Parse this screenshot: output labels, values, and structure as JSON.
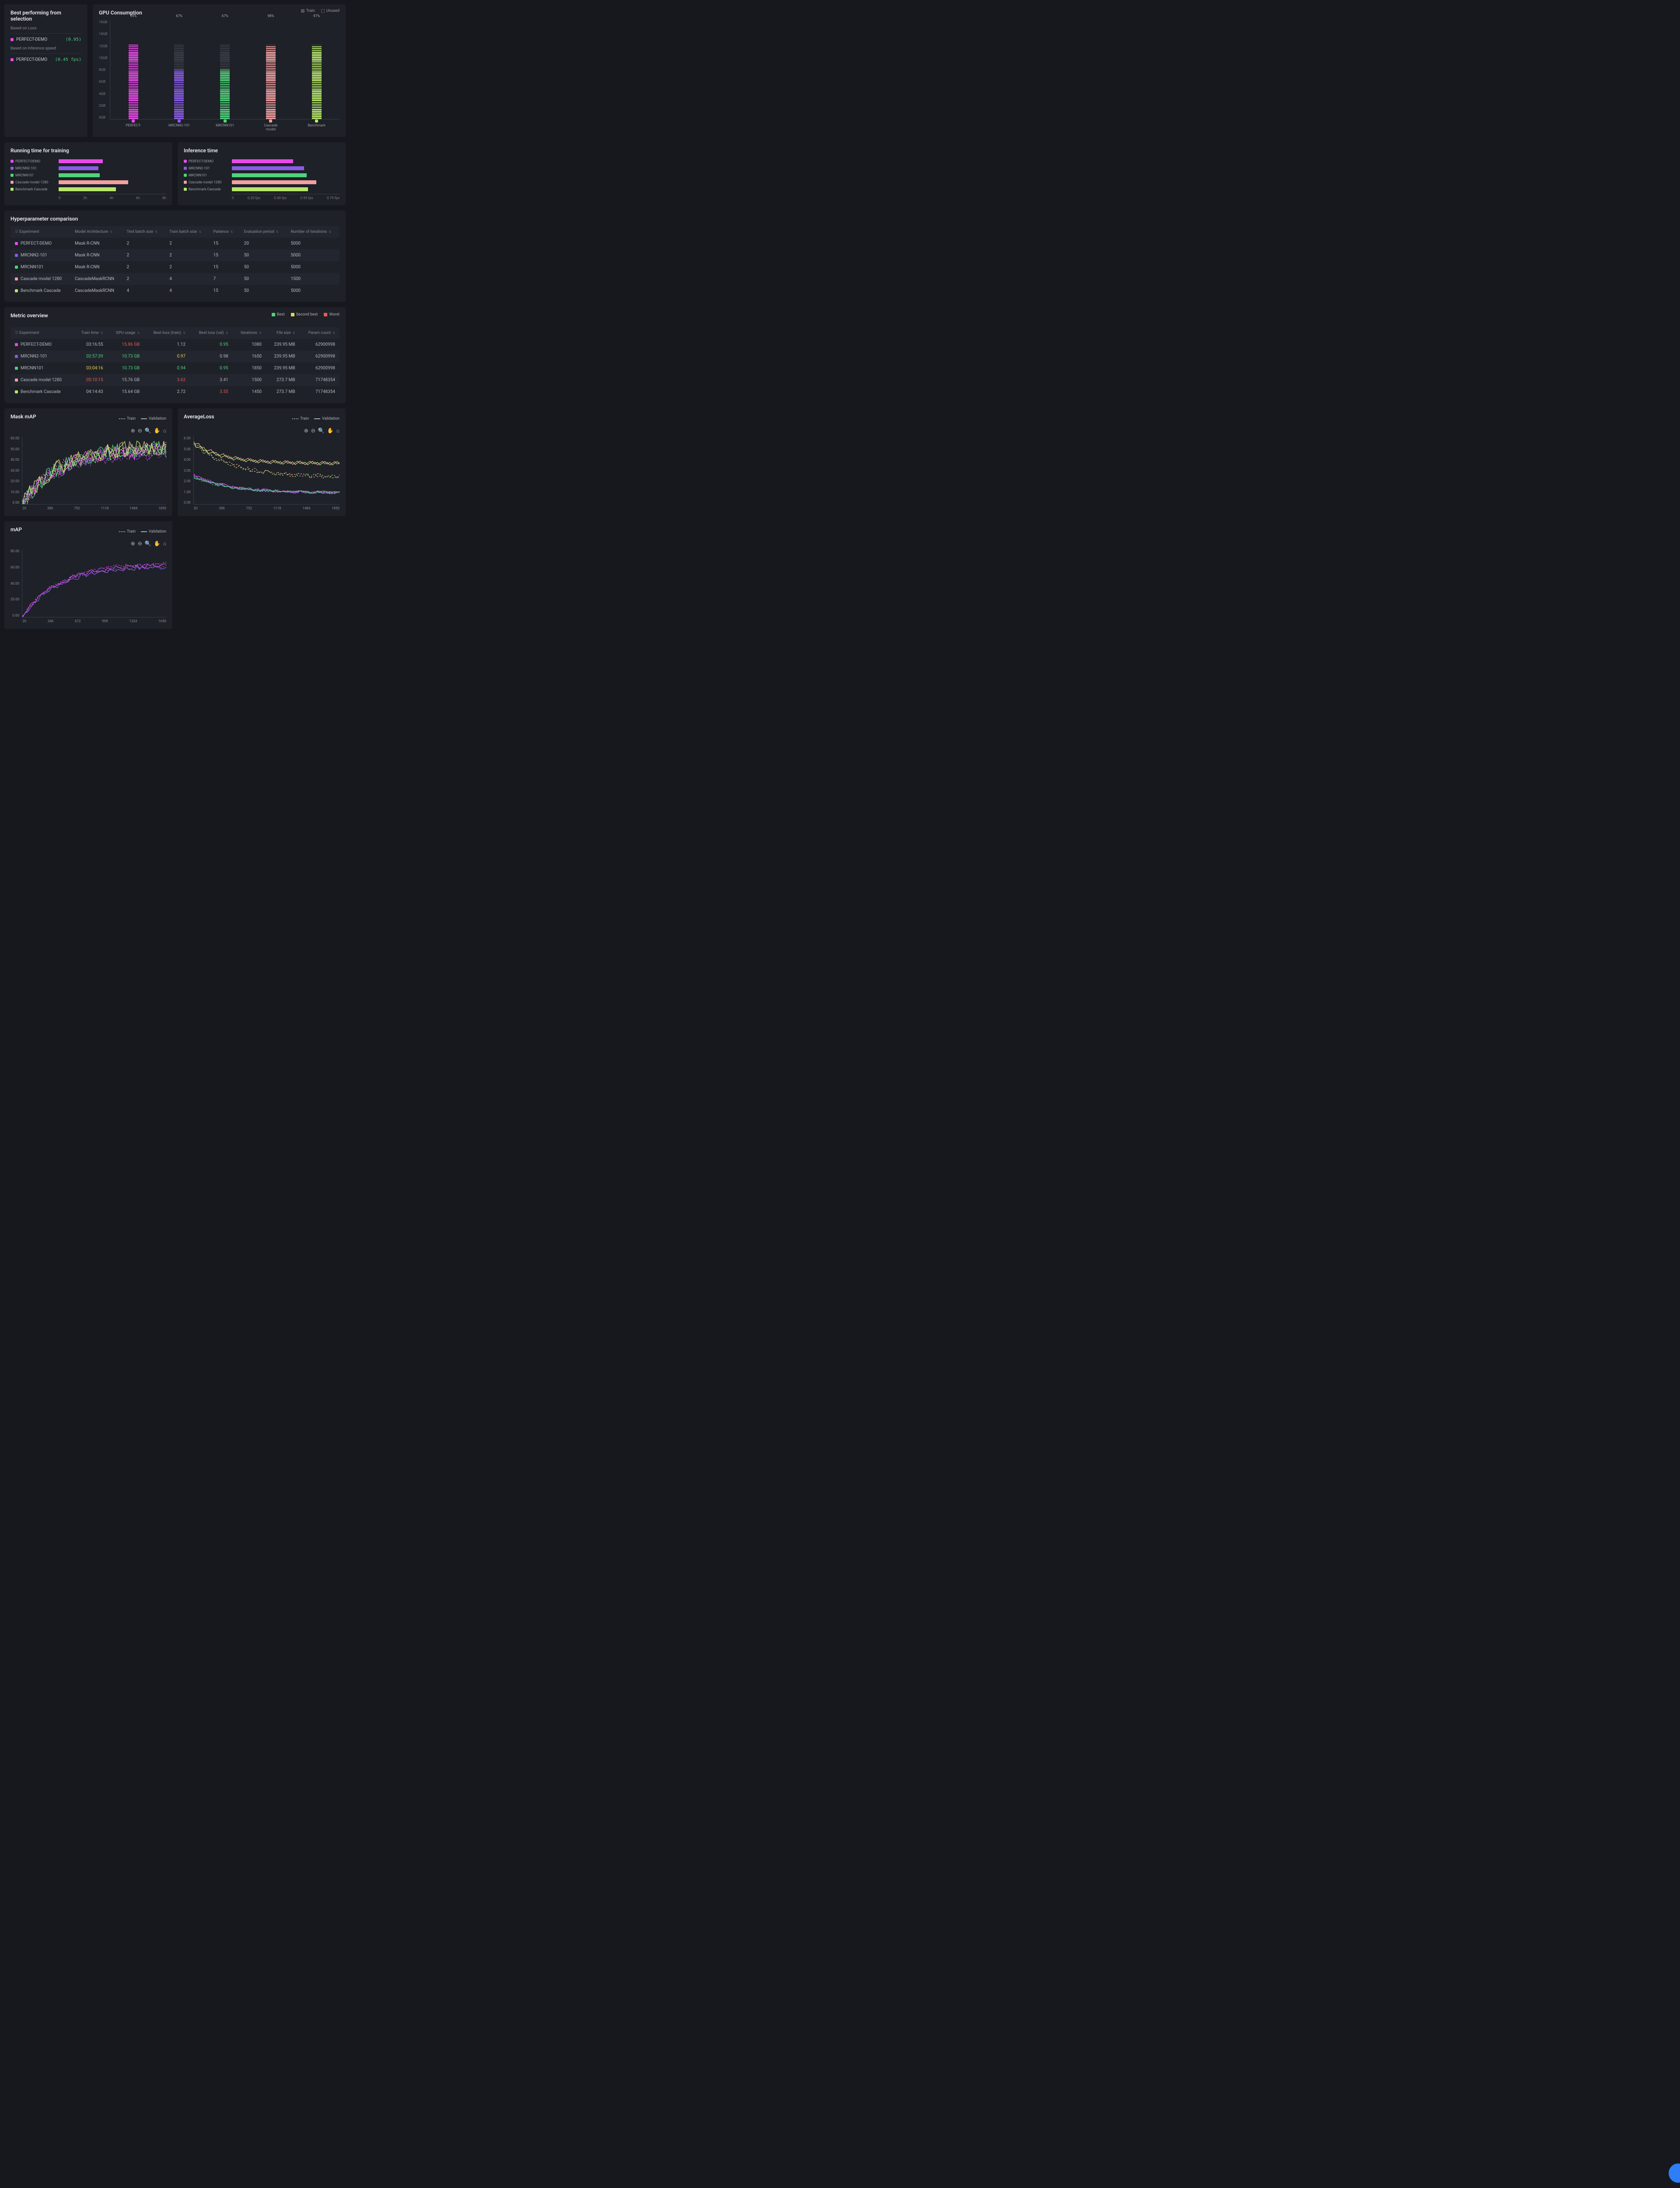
{
  "colors": {
    "perfect": "#e84ae8",
    "mrcnn2": "#8a5ce8",
    "mrcnn101": "#4fd47a",
    "cascade": "#f2a0a0",
    "benchmark": "#b8e86a",
    "unused": "#3a3d45"
  },
  "bestPanel": {
    "title": "Best performing from selection",
    "lossLabel": "Based on Loss:",
    "speedLabel": "Based on Inference speed:",
    "lossWinner": "PERFECT-DEMO",
    "lossValue": "(0.95)",
    "speedWinner": "PERFECT-DEMO",
    "speedValue": "(0.45 fps)"
  },
  "gpu": {
    "title": "GPU Consumption",
    "legend": {
      "train": "Train",
      "unused": "Unused"
    },
    "yticks": [
      "16GB",
      "14GB",
      "12GB",
      "10GB",
      "8GB",
      "6GB",
      "4GB",
      "2GB",
      "0GB"
    ],
    "bars": [
      {
        "label": "PERFECT-",
        "pct": "99%",
        "train": 99,
        "color": "perfect"
      },
      {
        "label": "MRCNN2-101",
        "pct": "67%",
        "train": 67,
        "color": "mrcnn2"
      },
      {
        "label": "MRCNN101",
        "pct": "67%",
        "train": 67,
        "color": "mrcnn101"
      },
      {
        "label": "Cascade model",
        "pct": "98%",
        "train": 98,
        "color": "cascade"
      },
      {
        "label": "Benchmark",
        "pct": "97%",
        "train": 97,
        "color": "benchmark"
      }
    ]
  },
  "runTime": {
    "title": "Running time for training",
    "xticks": [
      "0",
      "2h",
      "4h",
      "6h",
      "8h"
    ],
    "max": 8,
    "rows": [
      {
        "name": "PERFECT-DEMO",
        "val": 3.28,
        "color": "perfect"
      },
      {
        "name": "MRCNN2-101",
        "val": 2.96,
        "color": "mrcnn2"
      },
      {
        "name": "MRCNN101",
        "val": 3.07,
        "color": "mrcnn101"
      },
      {
        "name": "Cascade model 1280",
        "val": 5.17,
        "color": "cascade"
      },
      {
        "name": "Benchmark Cascade",
        "val": 4.25,
        "color": "benchmark"
      }
    ]
  },
  "infTime": {
    "title": "Inference time",
    "xticks": [
      "0",
      "0.20 fps",
      "0.40 fps",
      "0.59 fps",
      "0.79 fps"
    ],
    "max": 0.79,
    "rows": [
      {
        "name": "PERFECT-DEMO",
        "val": 0.45,
        "color": "perfect"
      },
      {
        "name": "MRCNN2-101",
        "val": 0.53,
        "color": "mrcnn2"
      },
      {
        "name": "MRCNN101",
        "val": 0.55,
        "color": "mrcnn101"
      },
      {
        "name": "Cascade model 1280",
        "val": 0.62,
        "color": "cascade"
      },
      {
        "name": "Benchmark Cascade",
        "val": 0.56,
        "color": "benchmark"
      }
    ]
  },
  "hyper": {
    "title": "Hyperparameter comparison",
    "cols": [
      "Experiment",
      "Model Architecture",
      "Test batch size",
      "Train batch size",
      "Patience",
      "Evaluation period",
      "Number of iterations"
    ],
    "rows": [
      {
        "exp": "PERFECT-DEMO",
        "color": "perfect",
        "arch": "Mask R-CNN",
        "test": "2",
        "train": "2",
        "pat": "15",
        "eval": "20",
        "iter": "5000"
      },
      {
        "exp": "MRCNN2-101",
        "color": "mrcnn2",
        "arch": "Mask R-CNN",
        "test": "2",
        "train": "2",
        "pat": "15",
        "eval": "50",
        "iter": "5000"
      },
      {
        "exp": "MRCNN101",
        "color": "mrcnn101",
        "arch": "Mask R-CNN",
        "test": "2",
        "train": "2",
        "pat": "15",
        "eval": "50",
        "iter": "5000"
      },
      {
        "exp": "Cascade model 1280",
        "color": "cascade",
        "arch": "CascadeMaskRCNN",
        "test": "2",
        "train": "4",
        "pat": "7",
        "eval": "50",
        "iter": "1500"
      },
      {
        "exp": "Benchmark Cascade",
        "color": "benchmark",
        "arch": "CascadeMaskRCNN",
        "test": "4",
        "train": "4",
        "pat": "15",
        "eval": "50",
        "iter": "5000"
      }
    ]
  },
  "metric": {
    "title": "Metric overview",
    "legend": {
      "best": "Best",
      "second": "Second best",
      "worst": "Worst"
    },
    "cols": [
      "Experiment",
      "Train time",
      "GPU usage",
      "Best loss (train)",
      "Best loss (val)",
      "Iterations",
      "File size",
      "Param count"
    ],
    "rows": [
      {
        "exp": "PERFECT-DEMO",
        "color": "perfect",
        "train": {
          "v": "03:16:55"
        },
        "gpu": {
          "v": "15.86 GB",
          "c": "worst"
        },
        "blt": {
          "v": "1.12"
        },
        "blv": {
          "v": "0.95",
          "c": "best"
        },
        "iter": "1080",
        "fs": "239.95 MB",
        "pc": "62900998"
      },
      {
        "exp": "MRCNN2-101",
        "color": "mrcnn2",
        "train": {
          "v": "02:57:39",
          "c": "best"
        },
        "gpu": {
          "v": "10.73 GB",
          "c": "best"
        },
        "blt": {
          "v": "0.97",
          "c": "second"
        },
        "blv": {
          "v": "0.98"
        },
        "iter": "1650",
        "fs": "239.95 MB",
        "pc": "62900998"
      },
      {
        "exp": "MRCNN101",
        "color": "mrcnn101",
        "train": {
          "v": "03:04:16",
          "c": "second"
        },
        "gpu": {
          "v": "10.73 GB",
          "c": "best"
        },
        "blt": {
          "v": "0.94",
          "c": "best"
        },
        "blv": {
          "v": "0.95",
          "c": "best"
        },
        "iter": "1850",
        "fs": "239.95 MB",
        "pc": "62900998"
      },
      {
        "exp": "Cascade model 1280",
        "color": "cascade",
        "train": {
          "v": "05:10:15",
          "c": "worst"
        },
        "gpu": {
          "v": "15.76 GB"
        },
        "blt": {
          "v": "3.62",
          "c": "worst"
        },
        "blv": {
          "v": "3.41"
        },
        "iter": "1500",
        "fs": "273.7 MB",
        "pc": "71748354"
      },
      {
        "exp": "Benchmark Cascade",
        "color": "benchmark",
        "train": {
          "v": "04:14:43"
        },
        "gpu": {
          "v": "15.64 GB"
        },
        "blt": {
          "v": "2.72"
        },
        "blv": {
          "v": "3.55",
          "c": "worst"
        },
        "iter": "1450",
        "fs": "273.7 MB",
        "pc": "71748354"
      }
    ]
  },
  "lineCharts": {
    "legend": {
      "train": "Train",
      "val": "Validation"
    },
    "toolbar": [
      "zoom-in",
      "zoom-out",
      "reset",
      "pan",
      "home"
    ]
  },
  "chart_data": [
    {
      "type": "bar",
      "title": "GPU Consumption",
      "ylabel": "GB",
      "ylim": [
        0,
        16
      ],
      "categories": [
        "PERFECT-",
        "MRCNN2-101",
        "MRCNN101",
        "Cascade model",
        "Benchmark"
      ],
      "series": [
        {
          "name": "Train",
          "values": [
            15.86,
            10.73,
            10.73,
            15.76,
            15.64
          ]
        },
        {
          "name": "Unused",
          "values": [
            0.14,
            5.27,
            5.27,
            0.24,
            0.36
          ]
        }
      ],
      "percent_labels": [
        "99%",
        "67%",
        "67%",
        "98%",
        "97%"
      ]
    },
    {
      "type": "bar",
      "orientation": "horizontal",
      "title": "Running time for training",
      "xlabel": "hours",
      "xlim": [
        0,
        8
      ],
      "categories": [
        "PERFECT-DEMO",
        "MRCNN2-101",
        "MRCNN101",
        "Cascade model 1280",
        "Benchmark Cascade"
      ],
      "values": [
        3.28,
        2.96,
        3.07,
        5.17,
        4.25
      ]
    },
    {
      "type": "bar",
      "orientation": "horizontal",
      "title": "Inference time",
      "xlabel": "fps",
      "xlim": [
        0,
        0.79
      ],
      "categories": [
        "PERFECT-DEMO",
        "MRCNN2-101",
        "MRCNN101",
        "Cascade model 1280",
        "Benchmark Cascade"
      ],
      "values": [
        0.45,
        0.53,
        0.55,
        0.62,
        0.56
      ]
    },
    {
      "type": "line",
      "title": "Mask mAP",
      "xlim": [
        20,
        1850
      ],
      "ylim": [
        0,
        60
      ],
      "xticks": [
        20,
        386,
        752,
        1118,
        1484,
        1850
      ],
      "yticks": [
        0,
        10,
        20,
        30,
        40,
        50,
        60
      ],
      "note": "Multiple series (train dotted, validation solid) per experiment; noisy curves rising from ~0 to ~50 then plateau."
    },
    {
      "type": "line",
      "title": "AverageLoss",
      "xlim": [
        20,
        1850
      ],
      "ylim": [
        0,
        6
      ],
      "xticks": [
        20,
        386,
        752,
        1118,
        1484,
        1850
      ],
      "yticks": [
        0,
        1,
        2,
        3,
        4,
        5,
        6
      ],
      "note": "Two bands of curves: cascade/benchmark start ~5.5 decaying to ~3.6; perfect/mrcnn start ~2.5 decaying to ~1.0."
    },
    {
      "type": "line",
      "title": "mAP",
      "xlim": [
        20,
        1650
      ],
      "ylim": [
        0,
        80
      ],
      "xticks": [
        20,
        346,
        672,
        998,
        1324,
        1650
      ],
      "yticks": [
        0,
        20,
        40,
        60,
        80
      ],
      "note": "Purple/pink series rising from 0 to ~62 and plateauing."
    }
  ],
  "maskMap": {
    "title": "Mask mAP",
    "yticks": [
      "60.00",
      "50.00",
      "40.00",
      "30.00",
      "20.00",
      "10.00",
      "0.00"
    ],
    "xticks": [
      "20",
      "386",
      "752",
      "1118",
      "1484",
      "1850"
    ]
  },
  "avgLoss": {
    "title": "AverageLoss",
    "yticks": [
      "6.00",
      "5.00",
      "4.00",
      "3.00",
      "2.00",
      "1.00",
      "0.00"
    ],
    "xticks": [
      "20",
      "386",
      "752",
      "1118",
      "1484",
      "1850"
    ]
  },
  "map": {
    "title": "mAP",
    "yticks": [
      "80.00",
      "60.00",
      "40.00",
      "20.00",
      "0.00"
    ],
    "xticks": [
      "20",
      "346",
      "672",
      "998",
      "1324",
      "1650"
    ]
  }
}
